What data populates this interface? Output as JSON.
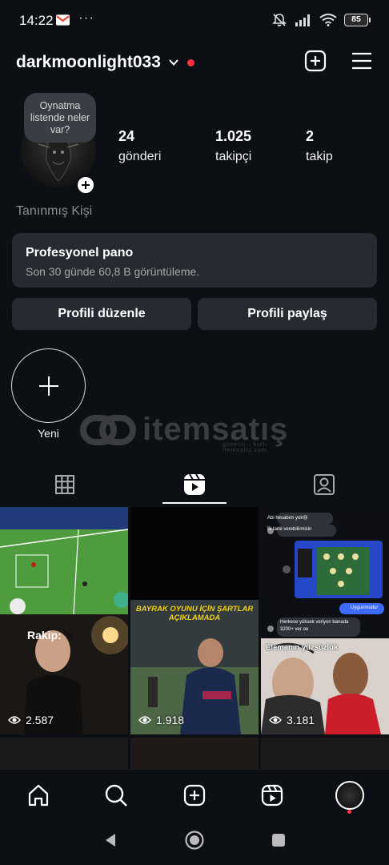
{
  "status_bar": {
    "time": "14:22",
    "dots": "···",
    "battery": "85"
  },
  "header": {
    "username": "darkmoonlight033"
  },
  "note": {
    "text": "Oynatma listende neler var?"
  },
  "stats": [
    {
      "value": "24",
      "label": "gönderi"
    },
    {
      "value": "1.025",
      "label": "takipçi"
    },
    {
      "value": "2",
      "label": "takip"
    }
  ],
  "profile": {
    "category": "Tanınmış Kişi"
  },
  "dashboard": {
    "title": "Profesyonel pano",
    "subtitle": "Son 30 günde 60,8 B görüntüleme."
  },
  "buttons": {
    "edit": "Profili düzenle",
    "share": "Profili paylaş"
  },
  "highlight": {
    "new_label": "Yeni"
  },
  "watermark": {
    "brand": "itemsatış",
    "tagline": "güvenli · hızlı · itemsatis.com"
  },
  "reels": [
    {
      "views": "2.587",
      "caption": "Rakip:"
    },
    {
      "views": "1.918",
      "caption": "BAYRAK OYUNU İÇİN ŞARTLAR AÇIKLAMADA"
    },
    {
      "views": "3.181",
      "caption": "Elemanın yüzsüzlük"
    }
  ],
  "chat": {
    "msg1": "Abi hesabım yok😢",
    "msg2": "Bi tane verebilirmisin",
    "msg3": "Uygunmudur",
    "msg4": "Herkese yüksek veriyon banada 3200+ ver oe"
  },
  "colors": {
    "background": "#0c0f14",
    "card": "#262a31",
    "accent_red": "#ff3040"
  }
}
